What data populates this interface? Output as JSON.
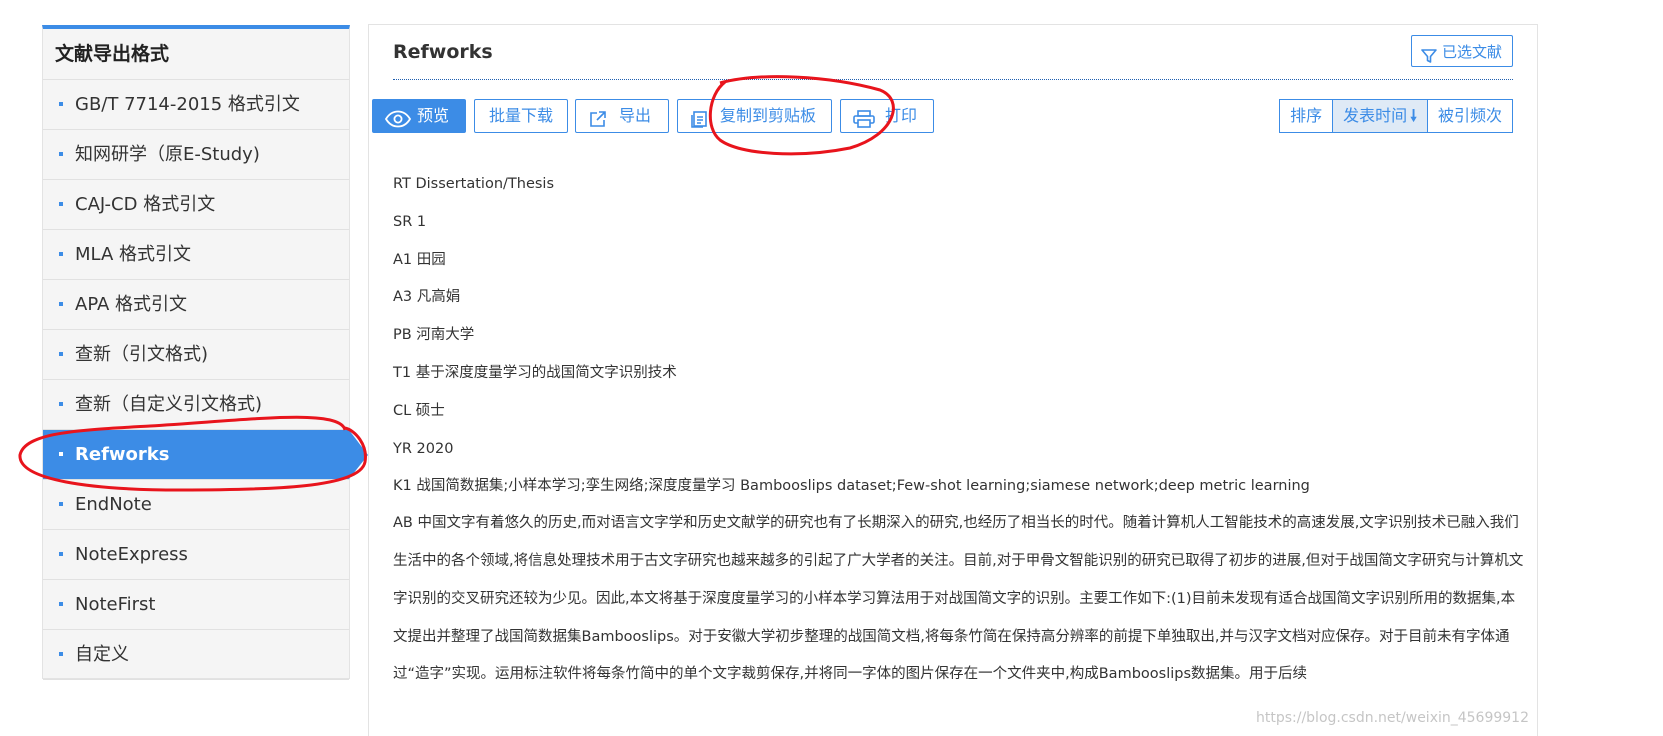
{
  "sidebar": {
    "title": "文献导出格式",
    "items": [
      {
        "label": "GB/T 7714-2015 格式引文"
      },
      {
        "label": "知网研学（原E-Study)"
      },
      {
        "label": "CAJ-CD 格式引文"
      },
      {
        "label": "MLA 格式引文"
      },
      {
        "label": "APA 格式引文"
      },
      {
        "label": "查新（引文格式)"
      },
      {
        "label": "查新（自定义引文格式)"
      },
      {
        "label": "Refworks"
      },
      {
        "label": "EndNote"
      },
      {
        "label": "NoteExpress"
      },
      {
        "label": "NoteFirst"
      },
      {
        "label": "自定义"
      }
    ],
    "active_index": 7
  },
  "main": {
    "title": "Refworks",
    "selected_button": "已选文献",
    "toolbar": {
      "preview": "预览",
      "batch_download": "批量下载",
      "export": "导出",
      "copy_clipboard": "复制到剪贴板",
      "print": "打印"
    },
    "sort": {
      "label": "排序",
      "by_date": "发表时间",
      "by_citations": "被引频次",
      "active": "发表时间",
      "direction_icon": "arrow-down-icon"
    },
    "record": {
      "rt": "RT Dissertation/Thesis",
      "sr": "SR 1",
      "a1": "A1 田园",
      "a3": "A3 凡高娟",
      "pb": "PB 河南大学",
      "t1": "T1 基于深度度量学习的战国简文字识别技术",
      "cl": "CL 硕士",
      "yr": "YR 2020",
      "k1": "K1 战国简数据集;小样本学习;孪生网络;深度度量学习 Bambooslips dataset;Few-shot learning;siamese network;deep metric learning",
      "ab": "AB 中国文字有着悠久的历史,而对语言文字学和历史文献学的研究也有了长期深入的研究,也经历了相当长的时代。随着计算机人工智能技术的高速发展,文字识别技术已融入我们生活中的各个领域,将信息处理技术用于古文字研究也越来越多的引起了广大学者的关注。目前,对于甲骨文智能识别的研究已取得了初步的进展,但对于战国简文字研究与计算机文字识别的交叉研究还较为少见。因此,本文将基于深度度量学习的小样本学习算法用于对战国简文字的识别。主要工作如下:(1)目前未发现有适合战国简文字识别所用的数据集,本文提出并整理了战国简数据集Bambooslips。对于安徽大学初步整理的战国简文档,将每条竹简在保持高分辨率的前提下单独取出,并与汉字文档对应保存。对于目前未有字体通过“造字”实现。运用标注软件将每条竹简中的单个文字裁剪保存,并将同一字体的图片保存在一个文件夹中,构成Bambooslips数据集。用于后续"
    },
    "watermark": "https://blog.csdn.net/weixin_45699912"
  },
  "colors": {
    "accent": "#3c8ce6",
    "annotation": "#e8141c"
  }
}
